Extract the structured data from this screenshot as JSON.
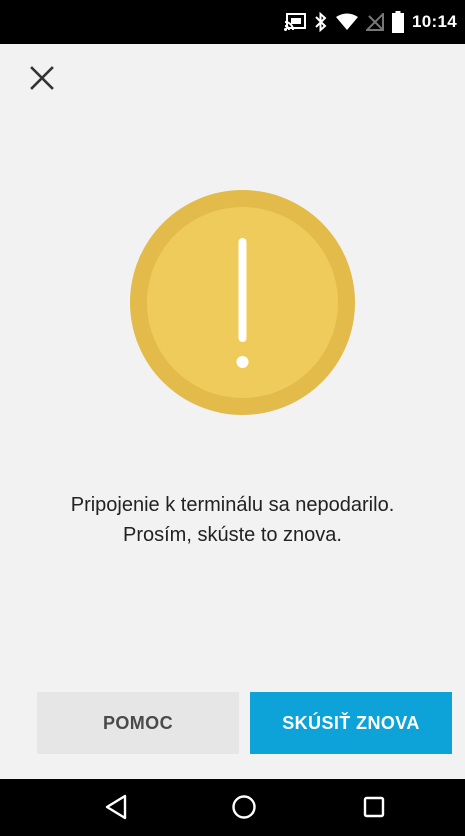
{
  "status_bar": {
    "time": "10:14",
    "icons": [
      "cast-icon",
      "bluetooth-icon",
      "wifi-icon",
      "no-sim-icon",
      "battery-icon"
    ]
  },
  "header": {
    "close_icon": "close-icon"
  },
  "alert": {
    "icon": "exclamation-icon",
    "colors": {
      "outer": "#e2bb4b",
      "inner": "#efcb5c",
      "mark": "#ffffff"
    },
    "message_line1": "Pripojenie k terminálu sa nepodarilo.",
    "message_line2": "Prosím, skúste to znova."
  },
  "actions": {
    "help_label": "POMOC",
    "retry_label": "SKÚSIŤ ZNOVA",
    "colors": {
      "help_bg": "#e6e6e6",
      "retry_bg": "#0ea3d8"
    }
  },
  "nav_bar": {
    "items": [
      "back-icon",
      "home-icon",
      "recents-icon"
    ]
  }
}
